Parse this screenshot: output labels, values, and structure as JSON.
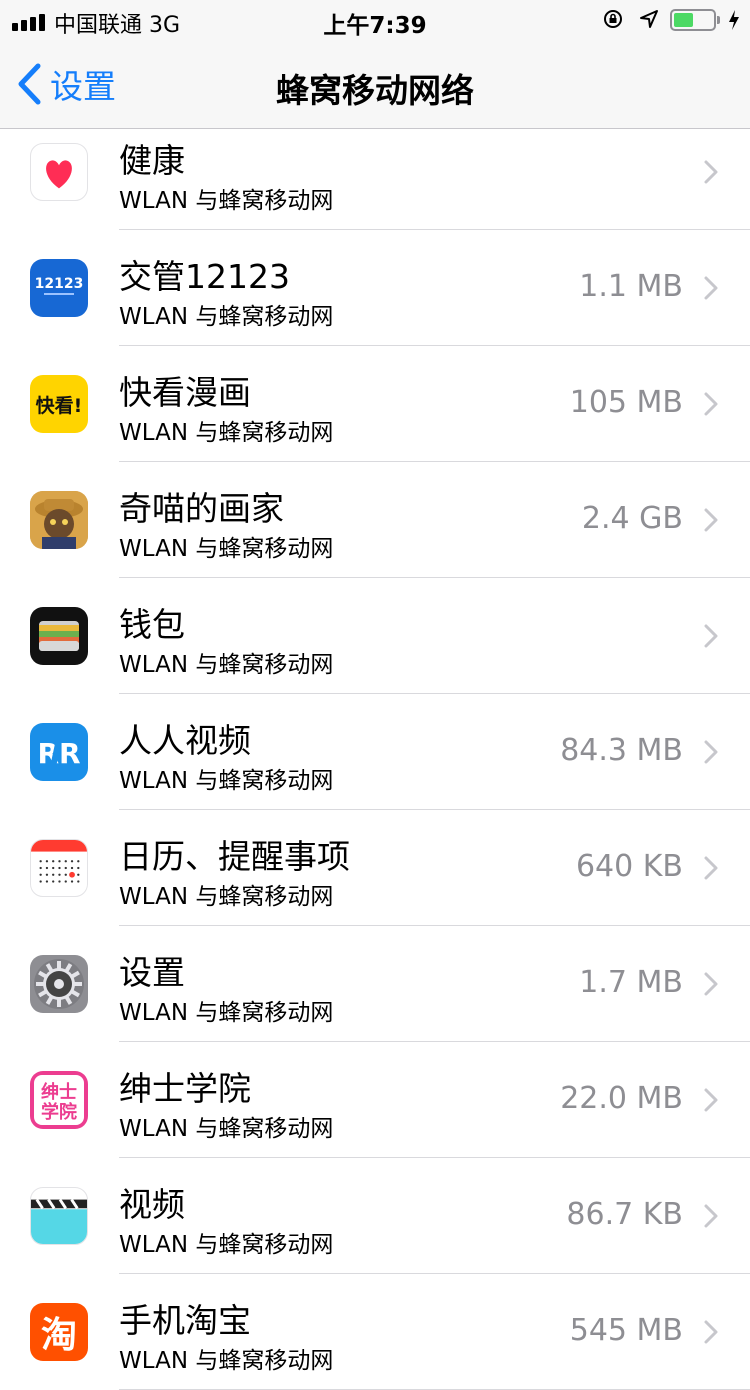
{
  "status_bar": {
    "carrier": "中国联通  3G",
    "time": "上午7:39",
    "battery_level": 0.5,
    "signal_bars": 4,
    "icons": [
      "signal-icon",
      "orientation-lock-icon",
      "location-icon",
      "battery-icon",
      "charging-icon"
    ]
  },
  "nav": {
    "back_label": "设置",
    "title": "蜂窝移动网络"
  },
  "apps": [
    {
      "name": "健康",
      "sub": "WLAN 与蜂窝移动网",
      "size": "",
      "icon": "health-icon"
    },
    {
      "name": "交管12123",
      "sub": "WLAN 与蜂窝移动网",
      "size": "1.1 MB",
      "icon": "jiaoguan-12123-icon",
      "icon_text": "12123"
    },
    {
      "name": "快看漫画",
      "sub": "WLAN 与蜂窝移动网",
      "size": "105 MB",
      "icon": "kuaikan-icon",
      "icon_text": "快看!"
    },
    {
      "name": "奇喵的画家",
      "sub": "WLAN 与蜂窝移动网",
      "size": "2.4 GB",
      "icon": "qimiao-icon"
    },
    {
      "name": "钱包",
      "sub": "WLAN 与蜂窝移动网",
      "size": "",
      "icon": "wallet-icon"
    },
    {
      "name": "人人视频",
      "sub": "WLAN 与蜂窝移动网",
      "size": "84.3 MB",
      "icon": "renren-icon"
    },
    {
      "name": "日历、提醒事项",
      "sub": "WLAN 与蜂窝移动网",
      "size": "640 KB",
      "icon": "calendar-icon"
    },
    {
      "name": "设置",
      "sub": "WLAN 与蜂窝移动网",
      "size": "1.7 MB",
      "icon": "settings-gear-icon"
    },
    {
      "name": "绅士学院",
      "sub": "WLAN 与蜂窝移动网",
      "size": "22.0 MB",
      "icon": "shenshi-icon",
      "icon_text": "绅士学院"
    },
    {
      "name": "视频",
      "sub": "WLAN 与蜂窝移动网",
      "size": "86.7 KB",
      "icon": "video-clapper-icon"
    },
    {
      "name": "手机淘宝",
      "sub": "WLAN 与蜂窝移动网",
      "size": "545 MB",
      "icon": "taobao-icon",
      "icon_text": "淘"
    }
  ],
  "colors": {
    "accent": "#157efb",
    "secondary_text": "#8e8e93",
    "battery": "#4cd964"
  }
}
